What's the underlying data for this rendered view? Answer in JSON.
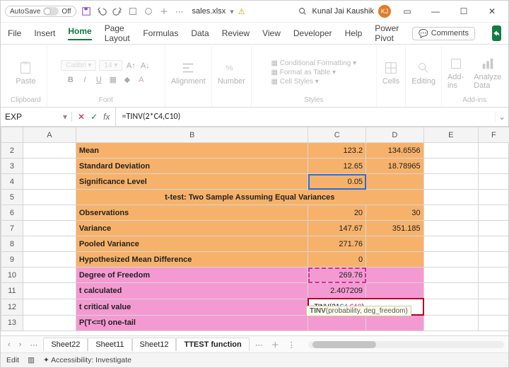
{
  "titlebar": {
    "autosave_label": "AutoSave",
    "autosave_state": "Off",
    "filename": "sales.xlsx",
    "user_name": "Kunal Jai Kaushik",
    "user_initials": "KJ"
  },
  "tabs": {
    "file": "File",
    "insert": "Insert",
    "home": "Home",
    "page_layout": "Page Layout",
    "formulas": "Formulas",
    "data": "Data",
    "review": "Review",
    "view": "View",
    "developer": "Developer",
    "help": "Help",
    "power_pivot": "Power Pivot",
    "comments": "Comments"
  },
  "ribbon": {
    "clipboard": {
      "label": "Clipboard",
      "paste": "Paste"
    },
    "font": {
      "label": "Font",
      "family_placeholder": "Calibri",
      "size_placeholder": "14"
    },
    "alignment": {
      "label": "Alignment",
      "btn": "Alignment"
    },
    "number": {
      "label": "Number",
      "btn": "Number"
    },
    "styles": {
      "label": "Styles",
      "cond": "Conditional Formatting",
      "table": "Format as Table",
      "cellstyles": "Cell Styles"
    },
    "cells": {
      "label": "Cells",
      "btn": "Cells"
    },
    "editing": {
      "label": "Editing",
      "btn": "Editing"
    },
    "addins": {
      "label": "Add-ins",
      "btn1": "Add-ins",
      "btn2": "Analyze Data"
    }
  },
  "formula_bar": {
    "name_box": "EXP",
    "formula": "=TINV(2*C4,C10)"
  },
  "columns": [
    "A",
    "B",
    "C",
    "D",
    "E",
    "F"
  ],
  "rows": [
    {
      "n": 2,
      "b": "Mean",
      "c": "123.2",
      "d": "134.6556",
      "cls": "orange"
    },
    {
      "n": 3,
      "b": "Standard Deviation",
      "c": "12.65",
      "d": "18.78965",
      "cls": "orange"
    },
    {
      "n": 4,
      "b": "Significance Level",
      "c": "0.05",
      "d": "",
      "cls": "orange"
    },
    {
      "n": 5,
      "b": "t-test: Two Sample Assuming Equal Variances",
      "center": true,
      "cls": "orange"
    },
    {
      "n": 6,
      "b": "Observations",
      "c": "20",
      "d": "30",
      "cls": "orange"
    },
    {
      "n": 7,
      "b": "Variance",
      "c": "147.67",
      "d": "351.185",
      "cls": "orange"
    },
    {
      "n": 8,
      "b": "Pooled Variance",
      "c": "271.76",
      "d": "",
      "cls": "orange"
    },
    {
      "n": 9,
      "b": "Hypothesized Mean Difference",
      "c": "0",
      "d": "",
      "cls": "orange"
    },
    {
      "n": 10,
      "b": "Degree of Freedom",
      "c": "269.76",
      "d": "",
      "cls": "pink"
    },
    {
      "n": 11,
      "b": "t calculated",
      "c": "2.407209",
      "d": "",
      "cls": "pink"
    },
    {
      "n": 12,
      "b": "t critical value",
      "c_formula": true,
      "cls": "pink"
    },
    {
      "n": 13,
      "b": "P(T<=t) one-tail",
      "c": "",
      "d": "",
      "cls": "pink"
    }
  ],
  "active_cell_formula": {
    "prefix": "=TINV(2*",
    "ref1": "C4",
    "mid": ",",
    "ref2": "C10",
    "suffix": ")"
  },
  "tooltip": {
    "fn": "TINV",
    "args": "(probability, deg_freedom)"
  },
  "sheet_tabs": [
    "Sheet22",
    "Sheet11",
    "Sheet12",
    "TTEST function"
  ],
  "active_sheet": "TTEST function",
  "status": {
    "mode": "Edit",
    "accessibility": "Accessibility: Investigate"
  }
}
